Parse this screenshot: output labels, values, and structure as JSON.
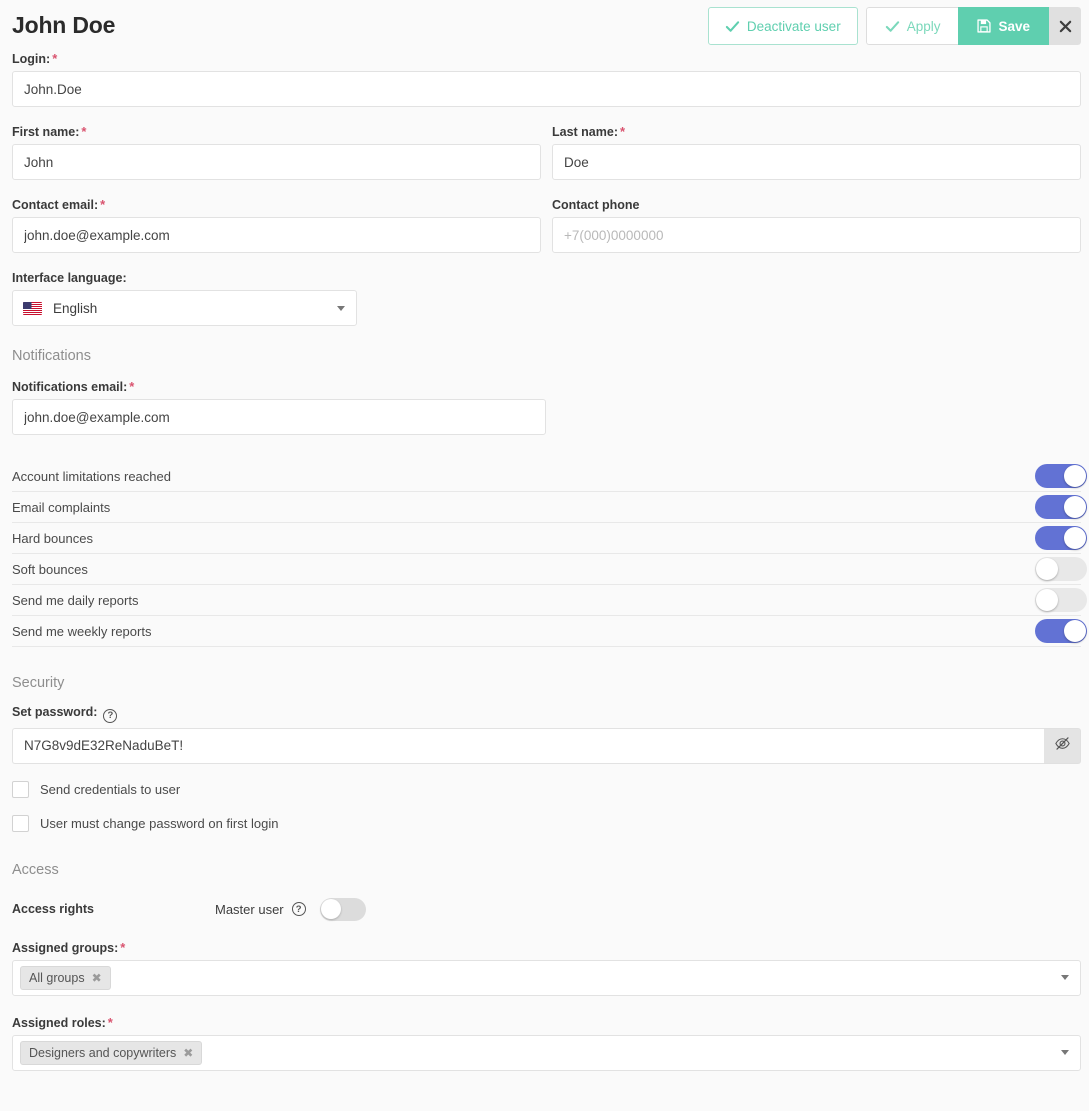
{
  "header": {
    "title": "John Doe",
    "deactivate_label": "Deactivate user",
    "apply_label": "Apply",
    "save_label": "Save"
  },
  "form": {
    "login": {
      "label": "Login:",
      "value": "John.Doe",
      "required": "*"
    },
    "first_name": {
      "label": "First name:",
      "value": "John",
      "required": "*"
    },
    "last_name": {
      "label": "Last name:",
      "value": "Doe",
      "required": "*"
    },
    "contact_email": {
      "label": "Contact email:",
      "value": "john.doe@example.com",
      "required": "*"
    },
    "contact_phone": {
      "label": "Contact phone",
      "value": "",
      "placeholder": "+7(000)0000000"
    },
    "interface_language": {
      "label": "Interface language:",
      "value": "English",
      "flag": "us-flag-icon"
    }
  },
  "notifications": {
    "section_title": "Notifications",
    "email": {
      "label": "Notifications email:",
      "value": "john.doe@example.com",
      "required": "*"
    },
    "toggles": [
      {
        "label": "Account limitations reached",
        "state": "on"
      },
      {
        "label": "Email complaints",
        "state": "on"
      },
      {
        "label": "Hard bounces",
        "state": "on"
      },
      {
        "label": "Soft bounces",
        "state": "off"
      },
      {
        "label": "Send me daily reports",
        "state": "off"
      },
      {
        "label": "Send me weekly reports",
        "state": "on"
      }
    ]
  },
  "security": {
    "section_title": "Security",
    "password": {
      "label": "Set password:",
      "value": "N7G8v9dE32ReNaduBeT!",
      "help": "?",
      "toggle_icon": "eye-slash-icon"
    },
    "checkboxes": [
      {
        "label": "Send credentials to user",
        "checked": false
      },
      {
        "label": "User must change password on first login",
        "checked": false
      }
    ]
  },
  "access": {
    "section_title": "Access",
    "access_rights_label": "Access rights",
    "master_user": {
      "label": "Master user",
      "help": "?",
      "state": "off"
    },
    "assigned_groups": {
      "label": "Assigned groups:",
      "required": "*",
      "tags": [
        "All groups"
      ]
    },
    "assigned_roles": {
      "label": "Assigned roles:",
      "required": "*",
      "tags": [
        "Designers and copywriters"
      ]
    }
  },
  "colors": {
    "accent_teal": "#5fcfaf",
    "toggle_on_blue": "#6272d4",
    "required_red": "#d9536f"
  }
}
